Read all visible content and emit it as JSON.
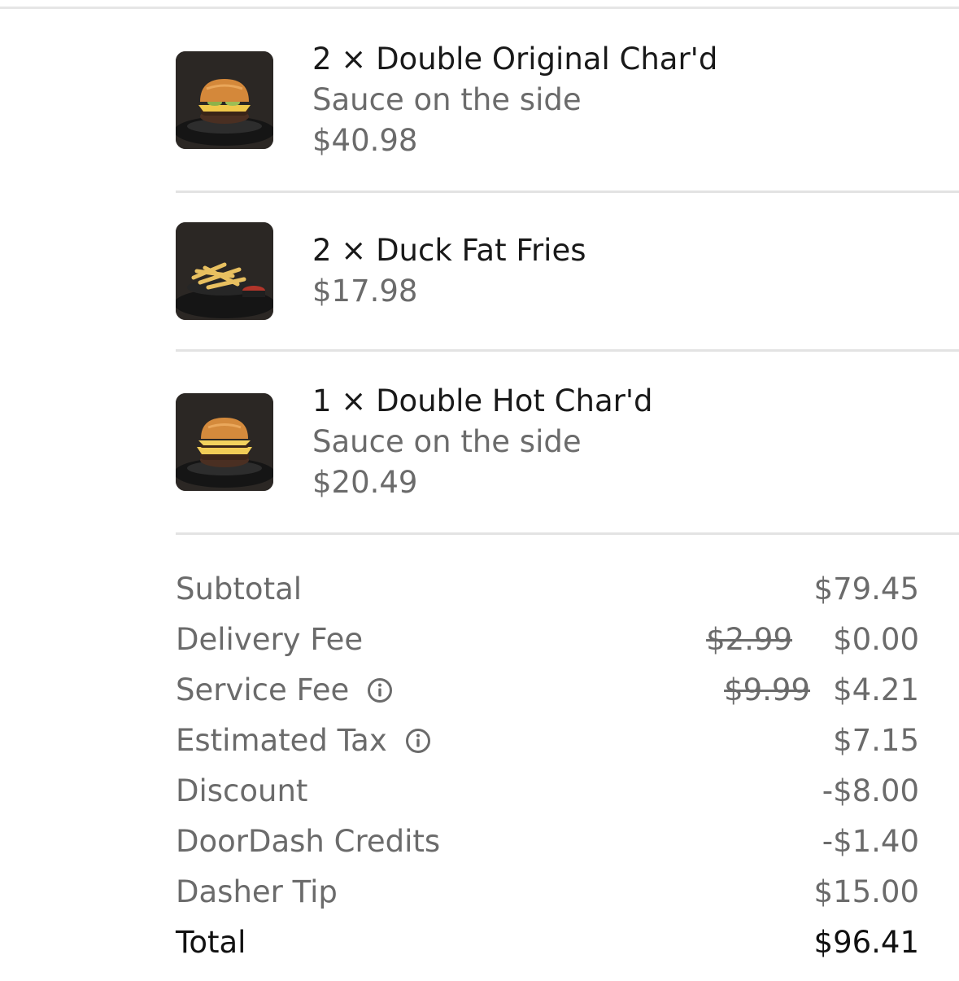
{
  "items": [
    {
      "title": "2 × Double Original Char'd",
      "note": "Sauce on the side",
      "price": "$40.98",
      "thumb_icon": "burger-photo"
    },
    {
      "title": "2 × Duck Fat Fries",
      "note": "",
      "price": "$17.98",
      "thumb_icon": "fries-photo"
    },
    {
      "title": "1 × Double Hot Char'd",
      "note": "Sauce on the side",
      "price": "$20.49",
      "thumb_icon": "burger-photo"
    }
  ],
  "summary": {
    "subtotal": {
      "label": "Subtotal",
      "value": "$79.45"
    },
    "delivery_fee": {
      "label": "Delivery Fee",
      "original": "$2.99",
      "value": "$0.00"
    },
    "service_fee": {
      "label": "Service Fee",
      "original": "$9.99",
      "value": "$4.21",
      "icon": "info-icon"
    },
    "estimated_tax": {
      "label": "Estimated Tax",
      "value": "$7.15",
      "icon": "info-icon"
    },
    "discount": {
      "label": "Discount",
      "value": "-$8.00"
    },
    "credits": {
      "label": "DoorDash Credits",
      "value": "-$1.40"
    },
    "tip": {
      "label": "Dasher Tip",
      "value": "$15.00"
    },
    "total": {
      "label": "Total",
      "value": "$96.41"
    }
  },
  "colors": {
    "primary_text": "#191919",
    "secondary_text": "#6b6b6b",
    "divider": "#e3e3e3"
  }
}
